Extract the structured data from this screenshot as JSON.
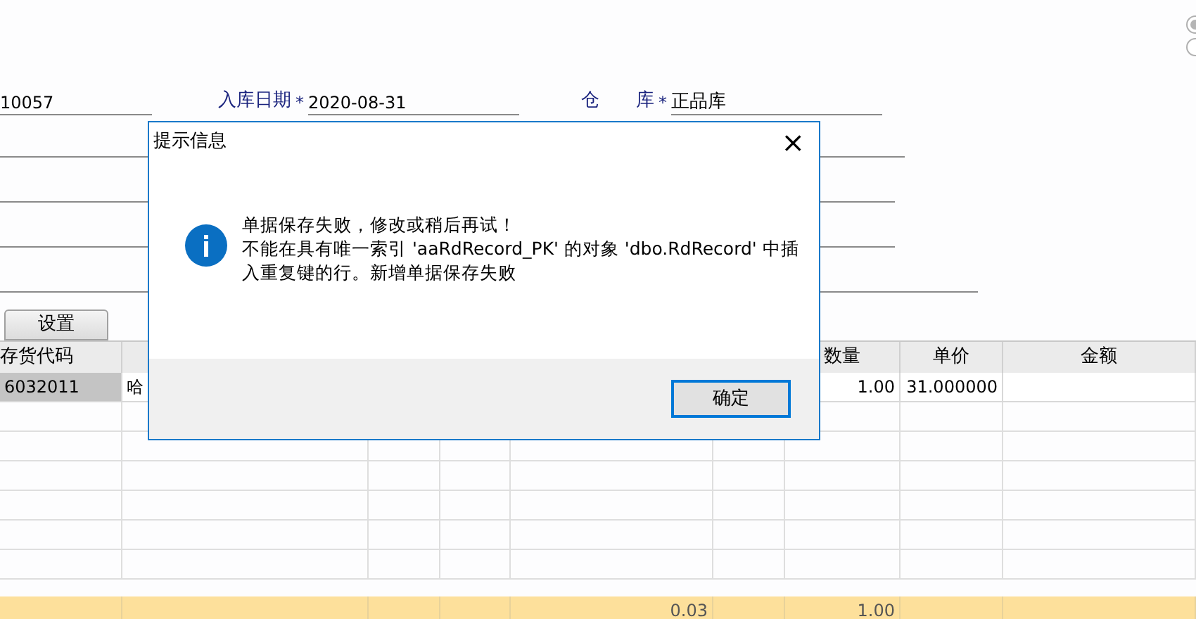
{
  "options": [
    {
      "selected": true
    },
    {
      "selected": false
    }
  ],
  "header_fields": [
    {
      "value": "10057"
    },
    {
      "label": "入库日期",
      "required_mark": "*",
      "value": "2020-08-31"
    },
    {
      "label": "仓　　库",
      "required_mark": "*",
      "value": "正品库"
    }
  ],
  "settings_button": "设置",
  "table": {
    "columns": [
      "存货代码",
      null,
      null,
      null,
      null,
      null,
      "数量",
      "单价",
      "金额"
    ],
    "rows": [
      {
        "selected": true,
        "cells": [
          "6032011",
          "哈",
          null,
          null,
          null,
          null,
          "1.00",
          "31.000000",
          null
        ]
      }
    ],
    "totals": {
      "column_5": "0.03",
      "quantity": "1.00"
    }
  },
  "dialog": {
    "title": "提示信息",
    "close": "×",
    "lines": [
      "单据保存失败，修改或稍后再试！",
      "不能在具有唯一索引 'aaRdRecord_PK' 的对象 'dbo.RdRecord' 中插",
      "入重复键的行。新增单据保存失败"
    ],
    "button": "确定"
  }
}
